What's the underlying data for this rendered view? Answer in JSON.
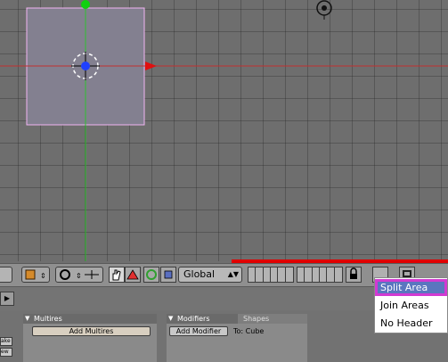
{
  "header": {
    "orientation_select": "Global"
  },
  "context_menu": {
    "items": [
      "Split Area",
      "Join Areas",
      "No Header"
    ],
    "highlighted_index": 0
  },
  "panels": {
    "multires_tab": "Multires",
    "add_multires_label": "Add Multires",
    "modifiers_tab": "Modifiers",
    "shapes_tab": "Shapes",
    "add_modifier_label": "Add Modifier",
    "to_object_label": "To: Cube",
    "side_buttons": [
      "ake",
      "ew"
    ]
  },
  "icons": [
    "viewport-type-icon",
    "object-mode-icon",
    "pivot-icon",
    "transform-manipulator-icon",
    "hand-icon",
    "triangle-icon",
    "ring-icon",
    "layer-icon",
    "lock-icon",
    "render-icon"
  ]
}
